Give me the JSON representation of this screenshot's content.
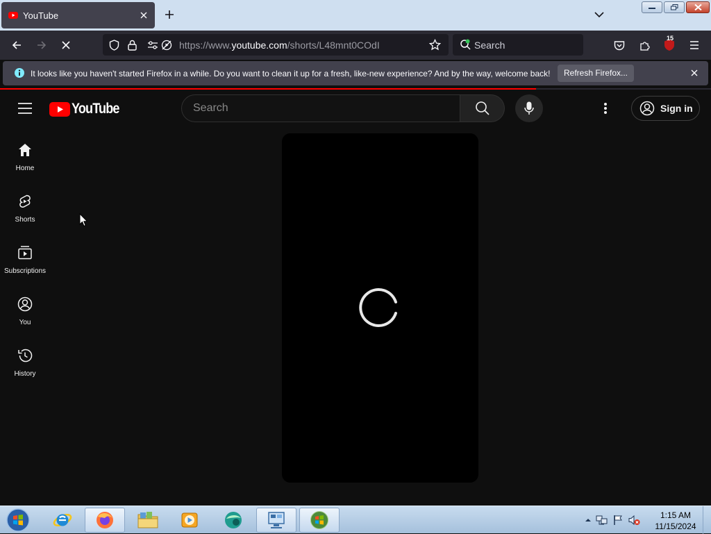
{
  "browser": {
    "tab_title": "YouTube",
    "url_prefix": "https://www.",
    "url_host": "youtube.com",
    "url_path": "/shorts/L48mnt0COdI",
    "search_placeholder": "Search",
    "extensions_badge": "15",
    "page_load_progress": 0.754
  },
  "notification": {
    "message": "It looks like you haven't started Firefox in a while. Do you want to clean it up for a fresh, like-new experience? And by the way, welcome back!",
    "button": "Refresh Firefox..."
  },
  "youtube": {
    "logo_text": "YouTube",
    "search_placeholder": "Search",
    "signin_label": "Sign in",
    "nav": [
      {
        "label": "Home",
        "icon": "home-icon"
      },
      {
        "label": "Shorts",
        "icon": "shorts-icon"
      },
      {
        "label": "Subscriptions",
        "icon": "subscriptions-icon"
      },
      {
        "label": "You",
        "icon": "you-icon"
      },
      {
        "label": "History",
        "icon": "history-icon"
      }
    ],
    "player_state": "loading"
  },
  "taskbar": {
    "apps": [
      "internet-explorer",
      "firefox",
      "file-explorer",
      "media-player",
      "app-sphere",
      "remote-desktop",
      "windows-app"
    ],
    "time": "1:15 AM",
    "date": "11/15/2024"
  },
  "colors": {
    "brand_red": "#ff0000",
    "page_bg": "#0f0f0f",
    "chrome_bg": "#2b2a33"
  }
}
